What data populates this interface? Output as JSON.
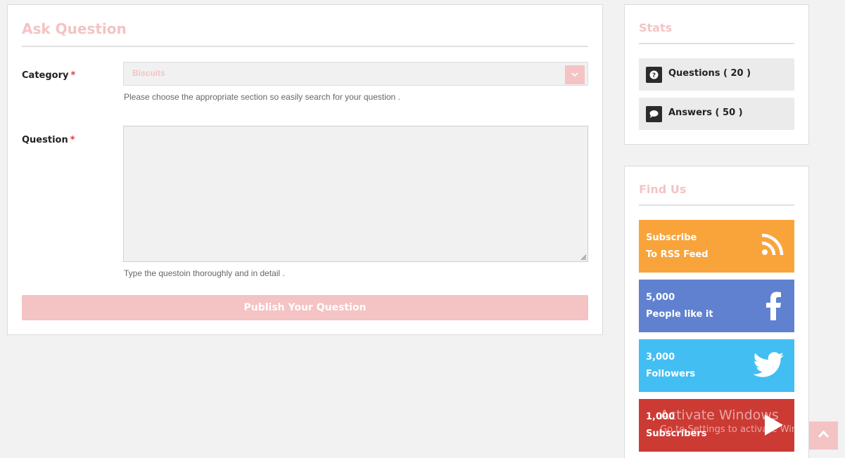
{
  "ask_question": {
    "title": "Ask Question",
    "category": {
      "label": "Category",
      "required_mark": "*",
      "selected": "Biscuits",
      "hint": "Please choose the appropriate section so easily search for your question ."
    },
    "question": {
      "label": "Question",
      "required_mark": "*",
      "value": "",
      "hint": "Type the questoin thoroughly and in detail ."
    },
    "publish_label": "Publish Your Question"
  },
  "stats": {
    "title": "Stats",
    "items": [
      {
        "label": "Questions ( 20 )",
        "icon": "question-icon"
      },
      {
        "label": "Answers ( 50 )",
        "icon": "comment-icon"
      }
    ]
  },
  "find_us": {
    "title": "Find Us",
    "items": [
      {
        "line1": "Subscribe",
        "line2": "To RSS Feed",
        "icon": "rss-icon",
        "color": "#f8a43b"
      },
      {
        "line1": "5,000",
        "line2": "People like it",
        "icon": "facebook-icon",
        "color": "#5f81cf"
      },
      {
        "line1": "3,000",
        "line2": "Followers",
        "icon": "twitter-icon",
        "color": "#42bef2"
      },
      {
        "line1": "1,000",
        "line2": "Subscribers",
        "icon": "youtube-play-icon",
        "color": "#cc3a34"
      }
    ]
  },
  "watermark": {
    "line1": "Activate Windows",
    "line2": "Go to Settings to activate Windows."
  },
  "colors": {
    "accent": "#f4c3c4",
    "background": "#f2f2f2"
  }
}
